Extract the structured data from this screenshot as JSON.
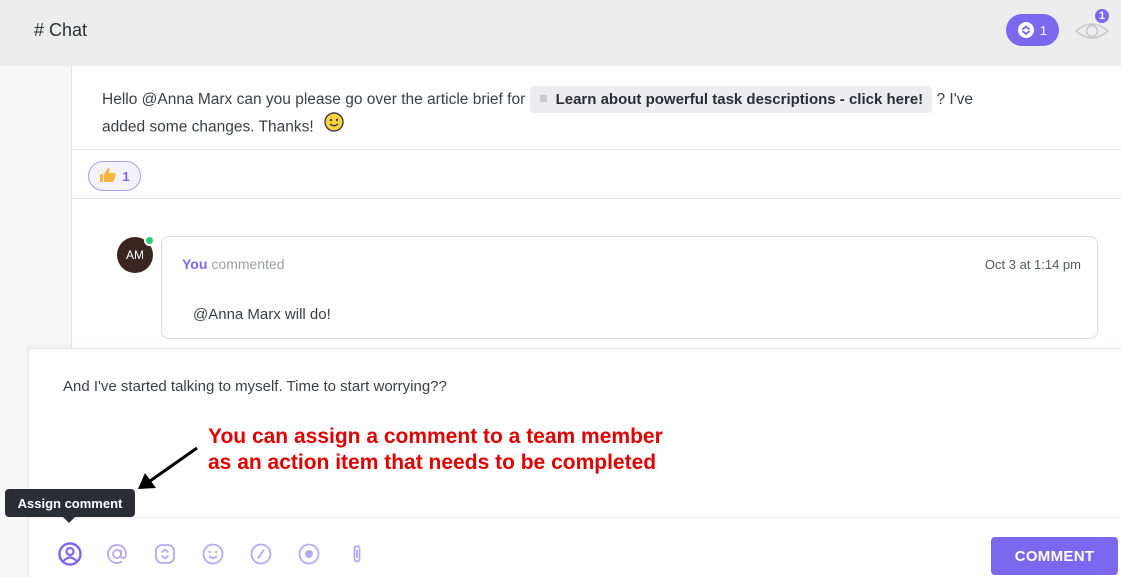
{
  "header": {
    "title": "# Chat",
    "subtasks_count": "1",
    "watchers_count": "1"
  },
  "thread": {
    "message_prefix": "Hello @Anna Marx can you please go over the article brief for ",
    "task_link_label": "Learn about powerful task descriptions - click here!",
    "message_suffix_1": " ? I've",
    "message_suffix_2": "added some changes. Thanks!",
    "reaction_count": "1",
    "reply": {
      "avatar_initials": "AM",
      "author": "You",
      "action": "commented",
      "timestamp": "Oct 3 at 1:14 pm",
      "body": "@Anna Marx will do!"
    }
  },
  "composer": {
    "draft_text": "And I've started talking to myself. Time to start worrying??",
    "tooltip": "Assign comment",
    "submit_label": "COMMENT",
    "tools": [
      "assign-comment-icon",
      "mention-icon",
      "task-icon",
      "emoji-icon",
      "slash-command-icon",
      "record-icon",
      "attachment-icon"
    ]
  },
  "annotation": {
    "line1": "You can assign a comment to a team member",
    "line2": "as an action item that needs to be completed"
  },
  "colors": {
    "accent": "#7b68ee",
    "annotation": "#e00000",
    "online": "#2ecc71"
  }
}
